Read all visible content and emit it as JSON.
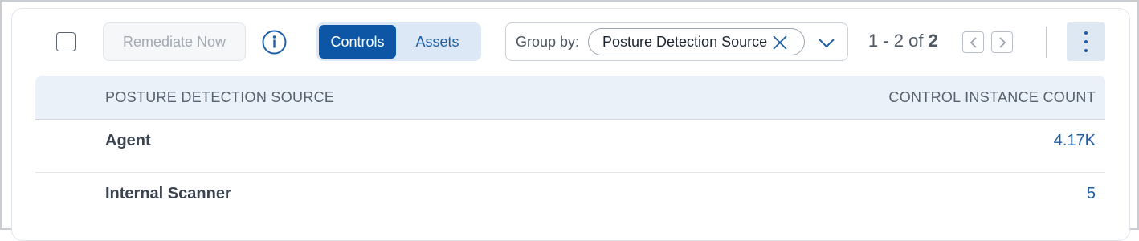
{
  "toolbar": {
    "remediate_label": "Remediate Now",
    "tabs": [
      {
        "label": "Controls",
        "active": true
      },
      {
        "label": "Assets",
        "active": false
      }
    ],
    "group_by": {
      "label": "Group by:",
      "selected": "Posture Detection Source"
    },
    "pagination": {
      "range": "1 - 2 of",
      "total": "2"
    }
  },
  "table": {
    "columns": [
      "POSTURE DETECTION SOURCE",
      "CONTROL INSTANCE COUNT"
    ],
    "rows": [
      {
        "source": "Agent",
        "count": "4.17K"
      },
      {
        "source": "Internal Scanner",
        "count": "5"
      }
    ]
  },
  "colors": {
    "accent": "#0d56a6",
    "header_bg": "#ebf1f8",
    "link": "#1d5ea8"
  }
}
